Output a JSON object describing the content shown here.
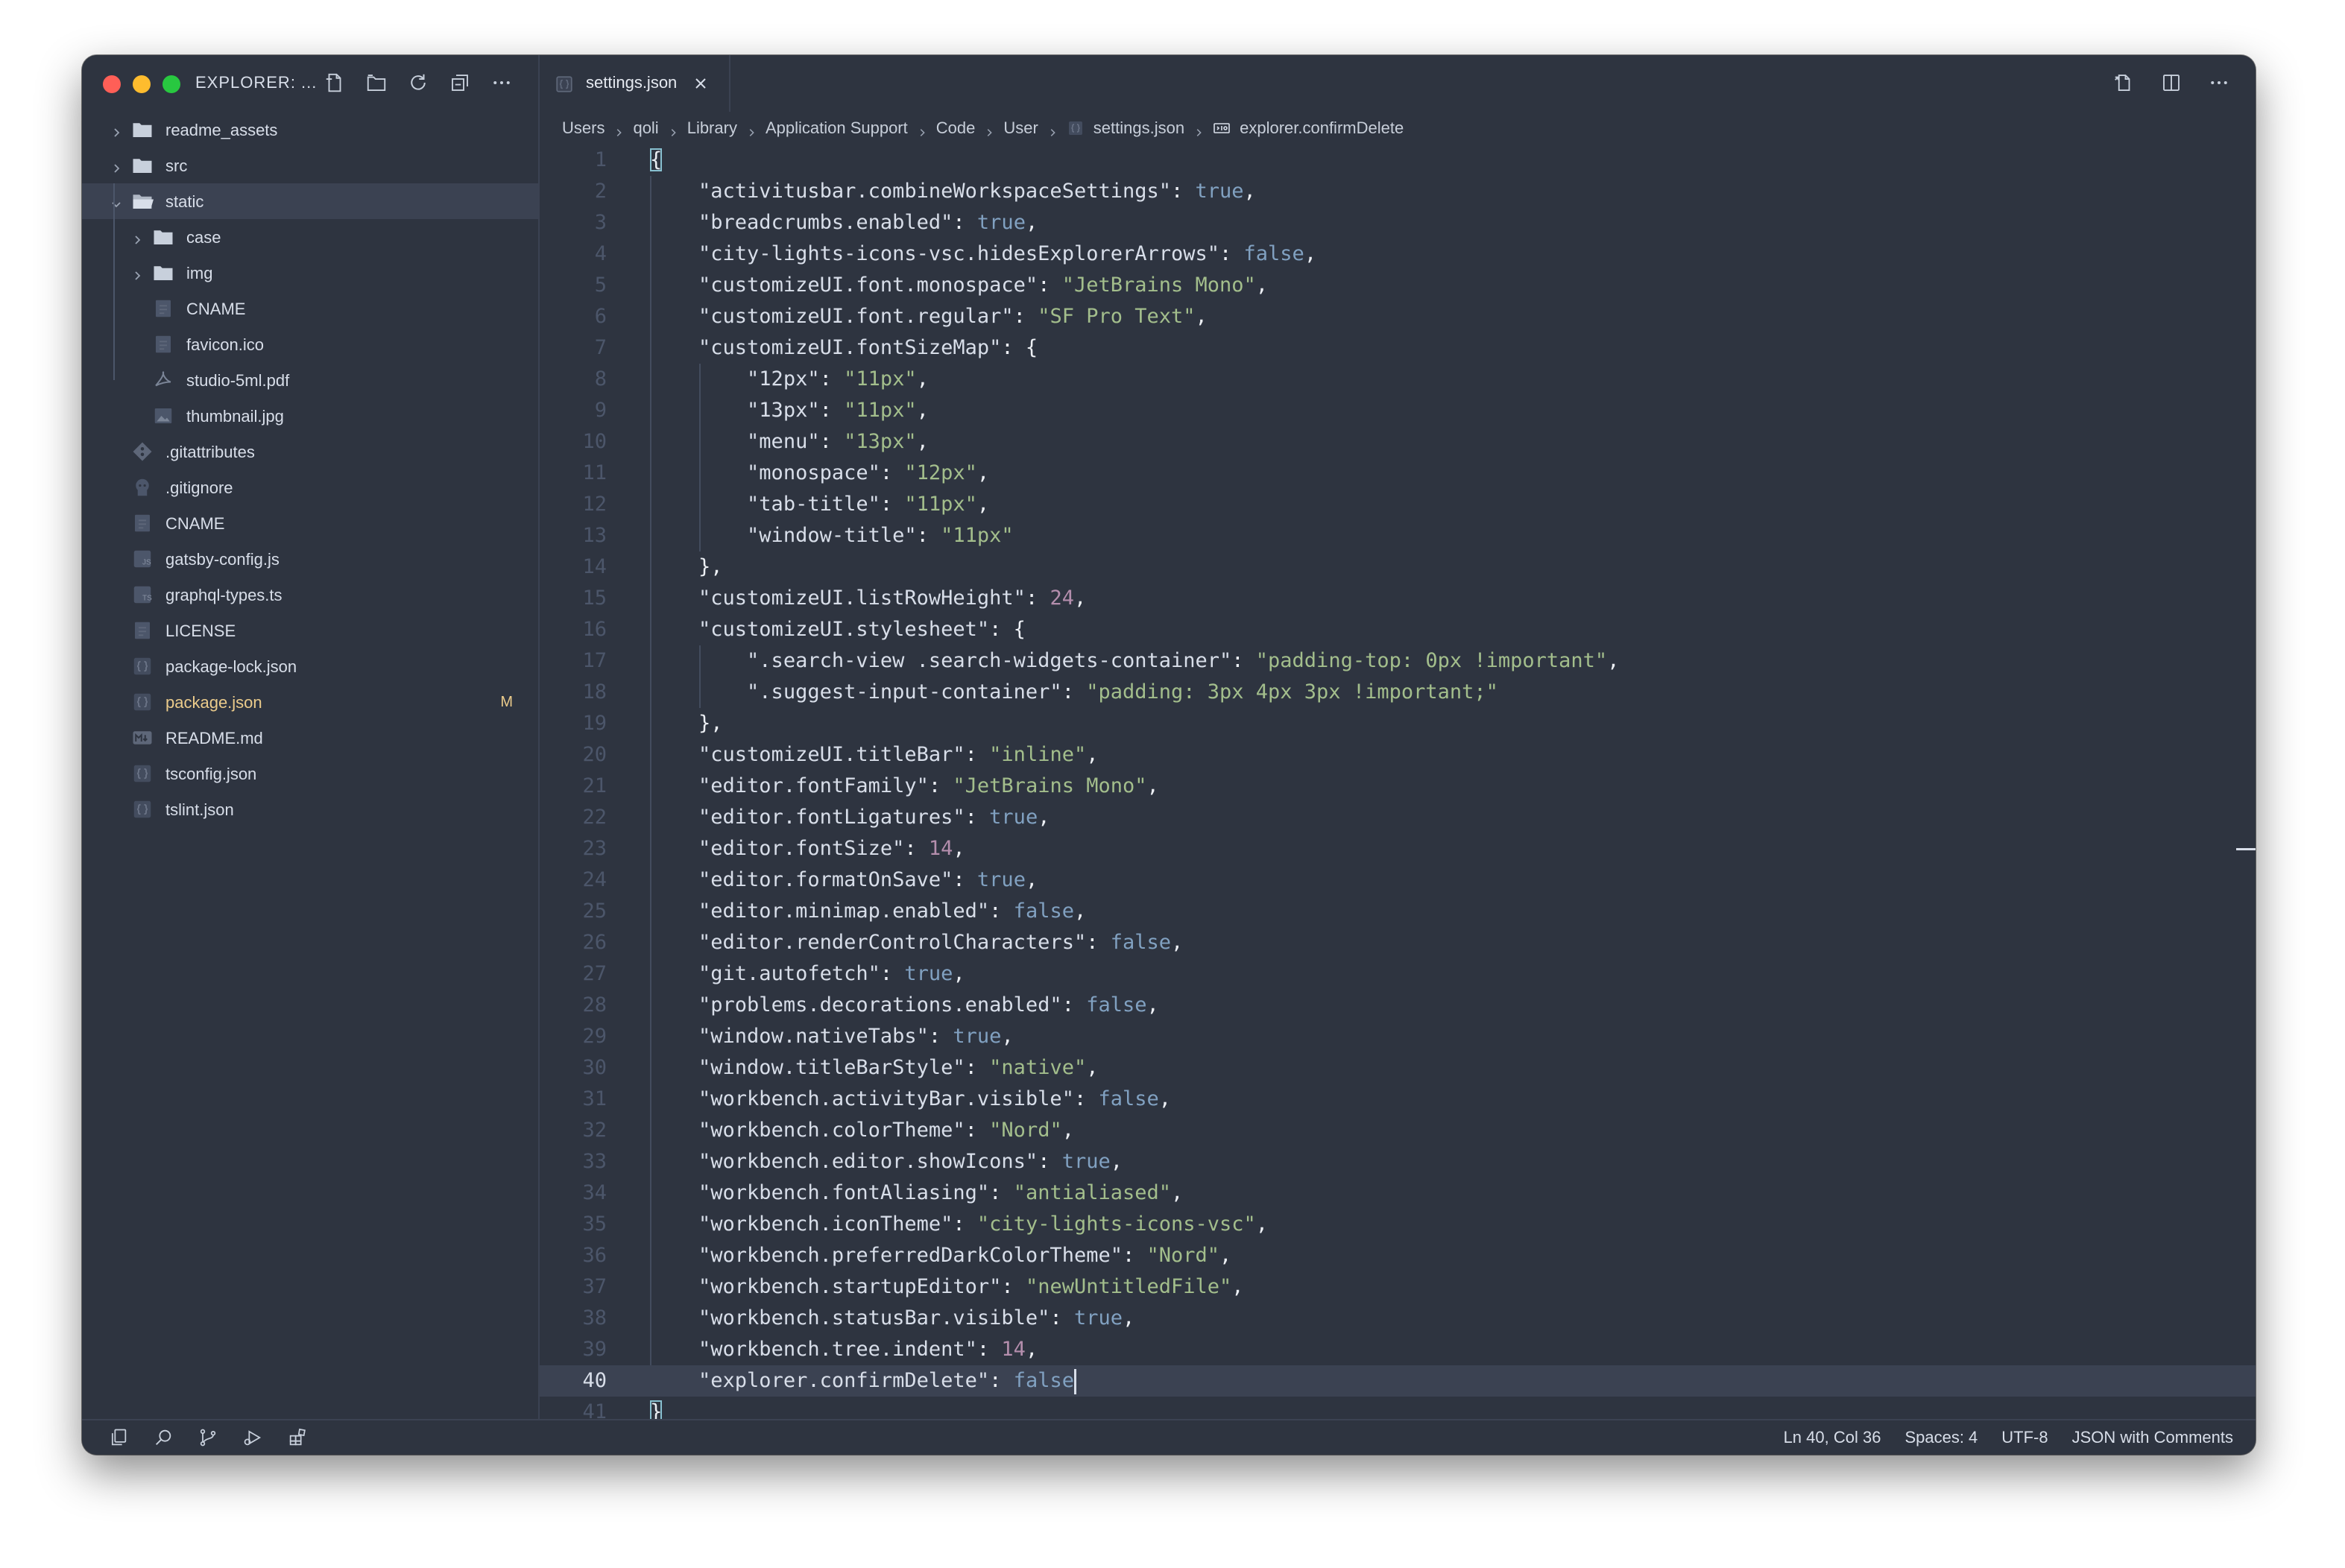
{
  "sidebar": {
    "title": "EXPLORER: ...",
    "actions": [
      "new-file-icon",
      "new-folder-icon",
      "refresh-icon",
      "collapse-all-icon",
      "more-icon"
    ],
    "items": [
      {
        "label": "readme_assets",
        "type": "folder",
        "depth": 0,
        "expanded": false
      },
      {
        "label": "src",
        "type": "folder",
        "depth": 0,
        "expanded": false
      },
      {
        "label": "static",
        "type": "folder",
        "depth": 0,
        "expanded": true,
        "selected": true
      },
      {
        "label": "case",
        "type": "folder",
        "depth": 1,
        "expanded": false
      },
      {
        "label": "img",
        "type": "folder",
        "depth": 1,
        "expanded": false
      },
      {
        "label": "CNAME",
        "type": "file",
        "icon": "file-icon",
        "depth": 1
      },
      {
        "label": "favicon.ico",
        "type": "file",
        "icon": "file-icon",
        "depth": 1
      },
      {
        "label": "studio-5ml.pdf",
        "type": "file",
        "icon": "pdf-icon",
        "depth": 1
      },
      {
        "label": "thumbnail.jpg",
        "type": "file",
        "icon": "image-icon",
        "depth": 1
      },
      {
        "label": ".gitattributes",
        "type": "file",
        "icon": "git-icon",
        "depth": 0
      },
      {
        "label": ".gitignore",
        "type": "file",
        "icon": "gitignore-icon",
        "depth": 0
      },
      {
        "label": "CNAME",
        "type": "file",
        "icon": "file-icon",
        "depth": 0
      },
      {
        "label": "gatsby-config.js",
        "type": "file",
        "icon": "js-icon",
        "depth": 0
      },
      {
        "label": "graphql-types.ts",
        "type": "file",
        "icon": "ts-icon",
        "depth": 0
      },
      {
        "label": "LICENSE",
        "type": "file",
        "icon": "file-icon",
        "depth": 0
      },
      {
        "label": "package-lock.json",
        "type": "file",
        "icon": "json-icon",
        "depth": 0
      },
      {
        "label": "package.json",
        "type": "file",
        "icon": "json-icon",
        "depth": 0,
        "modified": true,
        "badge": "M"
      },
      {
        "label": "README.md",
        "type": "file",
        "icon": "markdown-icon",
        "depth": 0
      },
      {
        "label": "tsconfig.json",
        "type": "file",
        "icon": "json-icon",
        "depth": 0
      },
      {
        "label": "tslint.json",
        "type": "file",
        "icon": "json-icon",
        "depth": 0
      }
    ]
  },
  "tab": {
    "label": "settings.json"
  },
  "breadcrumb": [
    {
      "label": "Users"
    },
    {
      "label": "qoli"
    },
    {
      "label": "Library"
    },
    {
      "label": "Application Support"
    },
    {
      "label": "Code"
    },
    {
      "label": "User"
    },
    {
      "label": "settings.json",
      "icon": "json-icon"
    },
    {
      "label": "explorer.confirmDelete",
      "icon": "boolean-icon"
    }
  ],
  "editor": {
    "current_line": 40,
    "lines": [
      [
        [
          "p",
          "{"
        ]
      ],
      [
        [
          "p",
          "    "
        ],
        [
          "k",
          "\"activitusbar.combineWorkspaceSettings\""
        ],
        [
          "p",
          ": "
        ],
        [
          "b",
          "true"
        ],
        [
          "p",
          ","
        ]
      ],
      [
        [
          "p",
          "    "
        ],
        [
          "k",
          "\"breadcrumbs.enabled\""
        ],
        [
          "p",
          ": "
        ],
        [
          "b",
          "true"
        ],
        [
          "p",
          ","
        ]
      ],
      [
        [
          "p",
          "    "
        ],
        [
          "k",
          "\"city-lights-icons-vsc.hidesExplorerArrows\""
        ],
        [
          "p",
          ": "
        ],
        [
          "b",
          "false"
        ],
        [
          "p",
          ","
        ]
      ],
      [
        [
          "p",
          "    "
        ],
        [
          "k",
          "\"customizeUI.font.monospace\""
        ],
        [
          "p",
          ": "
        ],
        [
          "s",
          "\"JetBrains Mono\""
        ],
        [
          "p",
          ","
        ]
      ],
      [
        [
          "p",
          "    "
        ],
        [
          "k",
          "\"customizeUI.font.regular\""
        ],
        [
          "p",
          ": "
        ],
        [
          "s",
          "\"SF Pro Text\""
        ],
        [
          "p",
          ","
        ]
      ],
      [
        [
          "p",
          "    "
        ],
        [
          "k",
          "\"customizeUI.fontSizeMap\""
        ],
        [
          "p",
          ": {"
        ]
      ],
      [
        [
          "p",
          "        "
        ],
        [
          "k",
          "\"12px\""
        ],
        [
          "p",
          ": "
        ],
        [
          "s",
          "\"11px\""
        ],
        [
          "p",
          ","
        ]
      ],
      [
        [
          "p",
          "        "
        ],
        [
          "k",
          "\"13px\""
        ],
        [
          "p",
          ": "
        ],
        [
          "s",
          "\"11px\""
        ],
        [
          "p",
          ","
        ]
      ],
      [
        [
          "p",
          "        "
        ],
        [
          "k",
          "\"menu\""
        ],
        [
          "p",
          ": "
        ],
        [
          "s",
          "\"13px\""
        ],
        [
          "p",
          ","
        ]
      ],
      [
        [
          "p",
          "        "
        ],
        [
          "k",
          "\"monospace\""
        ],
        [
          "p",
          ": "
        ],
        [
          "s",
          "\"12px\""
        ],
        [
          "p",
          ","
        ]
      ],
      [
        [
          "p",
          "        "
        ],
        [
          "k",
          "\"tab-title\""
        ],
        [
          "p",
          ": "
        ],
        [
          "s",
          "\"11px\""
        ],
        [
          "p",
          ","
        ]
      ],
      [
        [
          "p",
          "        "
        ],
        [
          "k",
          "\"window-title\""
        ],
        [
          "p",
          ": "
        ],
        [
          "s",
          "\"11px\""
        ]
      ],
      [
        [
          "p",
          "    },"
        ]
      ],
      [
        [
          "p",
          "    "
        ],
        [
          "k",
          "\"customizeUI.listRowHeight\""
        ],
        [
          "p",
          ": "
        ],
        [
          "n",
          "24"
        ],
        [
          "p",
          ","
        ]
      ],
      [
        [
          "p",
          "    "
        ],
        [
          "k",
          "\"customizeUI.stylesheet\""
        ],
        [
          "p",
          ": {"
        ]
      ],
      [
        [
          "p",
          "        "
        ],
        [
          "k",
          "\".search-view .search-widgets-container\""
        ],
        [
          "p",
          ": "
        ],
        [
          "s",
          "\"padding-top: 0px !important\""
        ],
        [
          "p",
          ","
        ]
      ],
      [
        [
          "p",
          "        "
        ],
        [
          "k",
          "\".suggest-input-container\""
        ],
        [
          "p",
          ": "
        ],
        [
          "s",
          "\"padding: 3px 4px 3px !important;\""
        ]
      ],
      [
        [
          "p",
          "    },"
        ]
      ],
      [
        [
          "p",
          "    "
        ],
        [
          "k",
          "\"customizeUI.titleBar\""
        ],
        [
          "p",
          ": "
        ],
        [
          "s",
          "\"inline\""
        ],
        [
          "p",
          ","
        ]
      ],
      [
        [
          "p",
          "    "
        ],
        [
          "k",
          "\"editor.fontFamily\""
        ],
        [
          "p",
          ": "
        ],
        [
          "s",
          "\"JetBrains Mono\""
        ],
        [
          "p",
          ","
        ]
      ],
      [
        [
          "p",
          "    "
        ],
        [
          "k",
          "\"editor.fontLigatures\""
        ],
        [
          "p",
          ": "
        ],
        [
          "b",
          "true"
        ],
        [
          "p",
          ","
        ]
      ],
      [
        [
          "p",
          "    "
        ],
        [
          "k",
          "\"editor.fontSize\""
        ],
        [
          "p",
          ": "
        ],
        [
          "n",
          "14"
        ],
        [
          "p",
          ","
        ]
      ],
      [
        [
          "p",
          "    "
        ],
        [
          "k",
          "\"editor.formatOnSave\""
        ],
        [
          "p",
          ": "
        ],
        [
          "b",
          "true"
        ],
        [
          "p",
          ","
        ]
      ],
      [
        [
          "p",
          "    "
        ],
        [
          "k",
          "\"editor.minimap.enabled\""
        ],
        [
          "p",
          ": "
        ],
        [
          "b",
          "false"
        ],
        [
          "p",
          ","
        ]
      ],
      [
        [
          "p",
          "    "
        ],
        [
          "k",
          "\"editor.renderControlCharacters\""
        ],
        [
          "p",
          ": "
        ],
        [
          "b",
          "false"
        ],
        [
          "p",
          ","
        ]
      ],
      [
        [
          "p",
          "    "
        ],
        [
          "k",
          "\"git.autofetch\""
        ],
        [
          "p",
          ": "
        ],
        [
          "b",
          "true"
        ],
        [
          "p",
          ","
        ]
      ],
      [
        [
          "p",
          "    "
        ],
        [
          "k",
          "\"problems.decorations.enabled\""
        ],
        [
          "p",
          ": "
        ],
        [
          "b",
          "false"
        ],
        [
          "p",
          ","
        ]
      ],
      [
        [
          "p",
          "    "
        ],
        [
          "k",
          "\"window.nativeTabs\""
        ],
        [
          "p",
          ": "
        ],
        [
          "b",
          "true"
        ],
        [
          "p",
          ","
        ]
      ],
      [
        [
          "p",
          "    "
        ],
        [
          "k",
          "\"window.titleBarStyle\""
        ],
        [
          "p",
          ": "
        ],
        [
          "s",
          "\"native\""
        ],
        [
          "p",
          ","
        ]
      ],
      [
        [
          "p",
          "    "
        ],
        [
          "k",
          "\"workbench.activityBar.visible\""
        ],
        [
          "p",
          ": "
        ],
        [
          "b",
          "false"
        ],
        [
          "p",
          ","
        ]
      ],
      [
        [
          "p",
          "    "
        ],
        [
          "k",
          "\"workbench.colorTheme\""
        ],
        [
          "p",
          ": "
        ],
        [
          "s",
          "\"Nord\""
        ],
        [
          "p",
          ","
        ]
      ],
      [
        [
          "p",
          "    "
        ],
        [
          "k",
          "\"workbench.editor.showIcons\""
        ],
        [
          "p",
          ": "
        ],
        [
          "b",
          "true"
        ],
        [
          "p",
          ","
        ]
      ],
      [
        [
          "p",
          "    "
        ],
        [
          "k",
          "\"workbench.fontAliasing\""
        ],
        [
          "p",
          ": "
        ],
        [
          "s",
          "\"antialiased\""
        ],
        [
          "p",
          ","
        ]
      ],
      [
        [
          "p",
          "    "
        ],
        [
          "k",
          "\"workbench.iconTheme\""
        ],
        [
          "p",
          ": "
        ],
        [
          "s",
          "\"city-lights-icons-vsc\""
        ],
        [
          "p",
          ","
        ]
      ],
      [
        [
          "p",
          "    "
        ],
        [
          "k",
          "\"workbench.preferredDarkColorTheme\""
        ],
        [
          "p",
          ": "
        ],
        [
          "s",
          "\"Nord\""
        ],
        [
          "p",
          ","
        ]
      ],
      [
        [
          "p",
          "    "
        ],
        [
          "k",
          "\"workbench.startupEditor\""
        ],
        [
          "p",
          ": "
        ],
        [
          "s",
          "\"newUntitledFile\""
        ],
        [
          "p",
          ","
        ]
      ],
      [
        [
          "p",
          "    "
        ],
        [
          "k",
          "\"workbench.statusBar.visible\""
        ],
        [
          "p",
          ": "
        ],
        [
          "b",
          "true"
        ],
        [
          "p",
          ","
        ]
      ],
      [
        [
          "p",
          "    "
        ],
        [
          "k",
          "\"workbench.tree.indent\""
        ],
        [
          "p",
          ": "
        ],
        [
          "n",
          "14"
        ],
        [
          "p",
          ","
        ]
      ],
      [
        [
          "p",
          "    "
        ],
        [
          "k",
          "\"explorer.confirmDelete\""
        ],
        [
          "p",
          ": "
        ],
        [
          "b",
          "false"
        ]
      ],
      [
        [
          "p",
          "}"
        ]
      ]
    ]
  },
  "statusbar": {
    "left_icons": [
      "files-icon",
      "search-icon",
      "source-control-icon",
      "run-debug-icon",
      "extensions-icon"
    ],
    "position": "Ln 40, Col 36",
    "indent": "Spaces: 4",
    "encoding": "UTF-8",
    "language": "JSON with Comments"
  },
  "colors": {
    "background": "#2e3440",
    "current_line": "#3b4252",
    "key": "#d8dee9",
    "string": "#a3be8c",
    "boolean": "#81a1c1",
    "number": "#b48ead",
    "line_number": "#4c566a",
    "modified": "#ebcb8b",
    "folder": "#c8d0dc"
  }
}
